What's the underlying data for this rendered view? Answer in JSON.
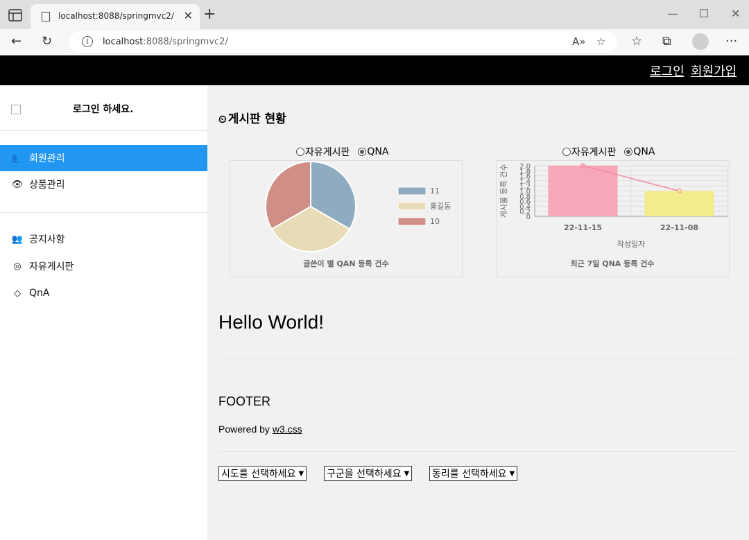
{
  "browser": {
    "tab_title": "localhost:8088/springmvc2/",
    "url_host": "localhost",
    "url_rest": ":8088/springmvc2/"
  },
  "topnav": {
    "login": "로그인",
    "signup": "회원가입"
  },
  "sidebar": {
    "greeting": "로그인 하세요.",
    "items": [
      {
        "label": "회원관리",
        "icon": "users-icon"
      },
      {
        "label": "상품관리",
        "icon": "eye-icon"
      },
      {
        "label": "공지사항",
        "icon": "users-icon"
      },
      {
        "label": "자유게시판",
        "icon": "bullseye-icon"
      },
      {
        "label": "QnA",
        "icon": "diamond-icon"
      }
    ]
  },
  "dashboard": {
    "title": "게시판 현황",
    "radio_free": "자유게시판",
    "radio_qna": "QNA"
  },
  "chart_data": [
    {
      "type": "pie",
      "title": "글쓴이 별 QAN 등록 건수",
      "categories": [
        "11",
        "홍길동",
        "10"
      ],
      "values": [
        1,
        1,
        1
      ],
      "colors": [
        "#8eabbf",
        "#e8dcb7",
        "#d08f86"
      ],
      "legend": "right"
    },
    {
      "type": "bar",
      "title": "최근 7일 QNA 등록 건수",
      "xlabel": "작성일자",
      "ylabel": "게시물 등록 건수",
      "categories": [
        "22-11-15",
        "22-11-08"
      ],
      "values": [
        2,
        1
      ],
      "ylim": [
        0,
        2
      ],
      "yticks": [
        "2.0",
        "1.8",
        "1.6",
        "1.4",
        "1.2",
        "1.0",
        "0.8",
        "0.6",
        "0.4",
        "0.2",
        "0"
      ],
      "colors": [
        "#f7a7b8",
        "#f3ec8c"
      ],
      "line_color": "#f08ca0",
      "grid": true
    }
  ],
  "main": {
    "hello": "Hello World!",
    "footer": "FOOTER",
    "powered_prefix": "Powered by ",
    "powered_link": "w3.css"
  },
  "selects": {
    "sido": "시도를 선택하세요",
    "gugun": "구군을 선택하세요",
    "dong": "동리를 선택하세요"
  }
}
